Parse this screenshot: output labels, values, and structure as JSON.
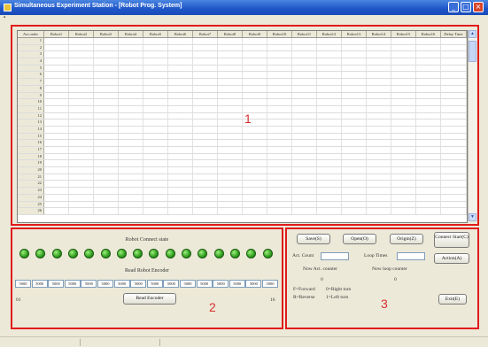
{
  "window": {
    "title": "Simultaneous Experiment Station - [Robot Prog. System]",
    "min_glyph": "_",
    "max_glyph": "□",
    "close_glyph": "×"
  },
  "grid": {
    "columns": [
      "Act.order",
      "Robot1",
      "Robot2",
      "Robot3",
      "Robot4",
      "Robot5",
      "Robot6",
      "Robot7",
      "Robot8",
      "Robot9",
      "Robot10",
      "Robot11",
      "Robot12",
      "Robot13",
      "Robot14",
      "Robot15",
      "Robot16",
      "Delay Time"
    ],
    "rows": [
      "1",
      "2",
      "3",
      "4",
      "5",
      "6",
      "7",
      "8",
      "9",
      "10",
      "11",
      "12",
      "13",
      "14",
      "15",
      "16",
      "17",
      "18",
      "19",
      "20",
      "21",
      "22",
      "23",
      "24",
      "25",
      "26"
    ],
    "scroll_up": "▲",
    "scroll_down": "▼"
  },
  "region_labels": {
    "one": "1",
    "two": "2",
    "three": "3"
  },
  "robot_panel": {
    "connect_title": "Robot Connect state",
    "led_count": 16,
    "encoder_title": "Read Robot Encoder",
    "encoder_values": [
      "5000",
      "5000",
      "5000",
      "5000",
      "5000",
      "5000",
      "5000",
      "5000",
      "5000",
      "5000",
      "5000",
      "5000",
      "5000",
      "5000",
      "5000",
      "5000"
    ],
    "first_index": "01",
    "last_index": "16",
    "read_button": "Read Encoder"
  },
  "control_panel": {
    "save_button": "Save(S)",
    "open_button": "Open(O)",
    "origin_button": "Origin(Z)",
    "connect_button": "Connect Start(C)",
    "action_button": "Action(A)",
    "exit_button": "Exit(E)",
    "act_count_label": "Act. Count",
    "act_count_value": "",
    "loop_times_label": "Loop Times",
    "loop_times_value": "",
    "now_act_label": "Now Act. counter",
    "now_loop_label": "Now loop counter",
    "now_act_value": "0",
    "now_loop_value": "0",
    "legend_forward": "F=Forward",
    "legend_reverse": "R=Reverse",
    "legend_right": "0=Right turn",
    "legend_left": "1=Left turn"
  }
}
